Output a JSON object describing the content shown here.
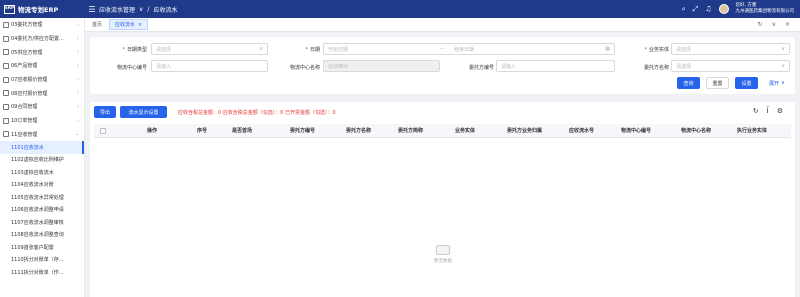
{
  "app": {
    "logo_mark": "ERP",
    "title": "物流专划ERP"
  },
  "breadcrumb": [
    "应收流水管理",
    "应收流水"
  ],
  "user": {
    "name": "您好, 方塞",
    "org": "九州通医药集团物流有限公司"
  },
  "sidebar": {
    "items": [
      {
        "label": "03委托方管理",
        "expanded": false
      },
      {
        "label": "04委托方/供应方配置...",
        "expanded": false
      },
      {
        "label": "05供应方管理",
        "expanded": false
      },
      {
        "label": "06产品管理",
        "expanded": false
      },
      {
        "label": "07应收报价管理",
        "expanded": false
      },
      {
        "label": "08应付报价管理",
        "expanded": false
      },
      {
        "label": "09合同管理",
        "expanded": false
      },
      {
        "label": "10订单管理",
        "expanded": false
      },
      {
        "label": "11应收管理",
        "expanded": true
      }
    ],
    "subitems": [
      {
        "label": "1101应收流水",
        "active": true
      },
      {
        "label": "1102虚拟应收比例维护",
        "active": false
      },
      {
        "label": "1103虚拟应收流水",
        "active": false
      },
      {
        "label": "1104应收流水对账",
        "active": false
      },
      {
        "label": "1105应收流水异常处理",
        "active": false
      },
      {
        "label": "1106应收流水调整申请",
        "active": false
      },
      {
        "label": "1107应收流水调整审核",
        "active": false
      },
      {
        "label": "1108应收流水调整查询",
        "active": false
      },
      {
        "label": "1109首张客户配置",
        "active": false
      },
      {
        "label": "1110拆分对账单（存...",
        "active": false
      },
      {
        "label": "1111拆分对账单（作...",
        "active": false
      }
    ]
  },
  "tabs": [
    {
      "label": "首页",
      "active": false,
      "closable": false
    },
    {
      "label": "应收流水",
      "active": true,
      "closable": true
    }
  ],
  "tab_tools": [
    "refresh-icon",
    "chevron-down-icon",
    "close-icon"
  ],
  "filter": {
    "date_type": {
      "label": "日期类型",
      "required": true,
      "placeholder": "请选择"
    },
    "date": {
      "label": "日期",
      "required": true,
      "start_placeholder": "开始日期",
      "end_placeholder": "结束日期",
      "separator": "—"
    },
    "business_entity": {
      "label": "业务实体",
      "required": true,
      "placeholder": "请选择"
    },
    "center_code": {
      "label": "物流中心编号",
      "placeholder": "请输入"
    },
    "center_name": {
      "label": "物流中心名称",
      "placeholder": "自动带出"
    },
    "client_code": {
      "label": "委托方编号",
      "placeholder": "请输入"
    },
    "client_name": {
      "label": "委托方名称",
      "placeholder": "请选择"
    },
    "buttons": {
      "query": "查询",
      "reset": "重置",
      "settings": "设置",
      "expand": "展开"
    }
  },
  "toolbar": {
    "export": "导出",
    "display_settings": "流水显示设置",
    "summary": "应收含税总金额：0   应收含税总金额（勾选）：0   已开票金额（勾选）：0"
  },
  "table": {
    "columns": [
      "操作",
      "序号",
      "是否首场",
      "委托方编号",
      "委托方名称",
      "委托方简称",
      "业务实体",
      "委托方业务归属",
      "应收流水号",
      "物流中心编号",
      "物流中心名称",
      "执行业务实体"
    ],
    "rows": [],
    "empty_text": "暂无数据"
  },
  "colors": {
    "primary": "#2563eb",
    "topbar": "#1f3a8a",
    "danger": "#e53935"
  }
}
